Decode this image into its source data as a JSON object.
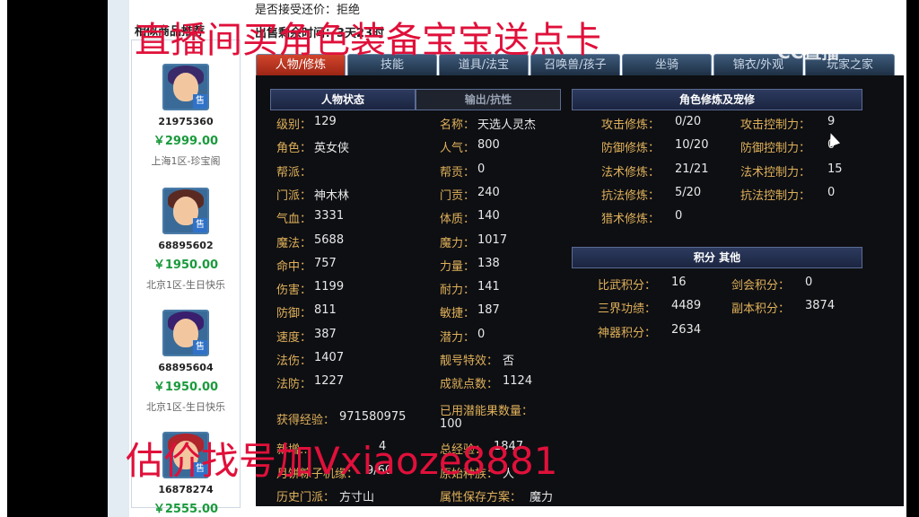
{
  "header": {
    "accept_offer_label": "是否接受还价：",
    "accept_offer_value": "拒绝",
    "left_title": "相似商品推荐",
    "sale_remaining": "出售剩余时间：3天23时"
  },
  "overlay": {
    "top_banner": "直播间买角色装备宝宝送点卡",
    "bottom_banner": "估价找号加Vxiaoze8881",
    "watermark_1": "CC直播",
    "watermark_2": "CC直播"
  },
  "sell_list": [
    {
      "id": "21975360",
      "price": "￥2999.00",
      "server": "上海1区-珍宝阁",
      "badge": "售"
    },
    {
      "id": "68895602",
      "price": "￥1950.00",
      "server": "北京1区-生日快乐",
      "badge": "售"
    },
    {
      "id": "68895604",
      "price": "￥1950.00",
      "server": "北京1区-生日快乐",
      "badge": "售"
    },
    {
      "id": "16878274",
      "price": "￥2555.00",
      "server": "",
      "badge": "售"
    }
  ],
  "tabs": [
    "人物/修炼",
    "技能",
    "道具/法宝",
    "召唤兽/孩子",
    "坐骑",
    "锦衣/外观",
    "玩家之家"
  ],
  "sections": {
    "char_status": "人物状态",
    "output_resist": "输出/抗性",
    "cultivation": "角色修炼及宠修",
    "score_other": "积分  其他"
  },
  "stats_left": [
    {
      "label": "级别：",
      "value": "129"
    },
    {
      "label": "角色：",
      "value": "英女侠"
    },
    {
      "label": "帮派：",
      "value": ""
    },
    {
      "label": "门派：",
      "value": "神木林"
    },
    {
      "label": "气血：",
      "value": "3331"
    },
    {
      "label": "魔法：",
      "value": "5688"
    },
    {
      "label": "命中：",
      "value": "757"
    },
    {
      "label": "伤害：",
      "value": "1199"
    },
    {
      "label": "防御：",
      "value": "811"
    },
    {
      "label": "速度：",
      "value": "387"
    },
    {
      "label": "法伤：",
      "value": "1407"
    },
    {
      "label": "法防：",
      "value": "1227"
    }
  ],
  "stats_right": [
    {
      "label": "名称：",
      "value": "天选人灵杰"
    },
    {
      "label": "人气：",
      "value": "800"
    },
    {
      "label": "帮贡：",
      "value": "0"
    },
    {
      "label": "门贡：",
      "value": "240"
    },
    {
      "label": "体质：",
      "value": "140"
    },
    {
      "label": "魔力：",
      "value": "1017"
    },
    {
      "label": "力量：",
      "value": "138"
    },
    {
      "label": "耐力：",
      "value": "141"
    },
    {
      "label": "敏捷：",
      "value": "187"
    },
    {
      "label": "潜力：",
      "value": "0"
    },
    {
      "label": "靓号特效：",
      "value": "否"
    },
    {
      "label": "成就点数：",
      "value": "1124"
    }
  ],
  "extra": {
    "exp_label": "获得经验：",
    "exp_value": "971580975",
    "potential_label": "已用潜能果数量：",
    "potential_value": "100",
    "new_label": "新增…",
    "new_value": "4",
    "total_exp_label": "总经验：",
    "total_exp_value": "1847",
    "month_label": "月饼粽子机缘：",
    "month_value": "9/60",
    "origin_label": "原始种族：",
    "origin_value": "人",
    "history_label": "历史门派：",
    "history_value": "方寸山",
    "save_label": "属性保存方案：",
    "save_value": "魔力"
  },
  "cultivation": [
    {
      "label": "攻击修炼：",
      "value": "0/20",
      "label2": "攻击控制力：",
      "value2": "9"
    },
    {
      "label": "防御修炼：",
      "value": "10/20",
      "label2": "防御控制力：",
      "value2": "0"
    },
    {
      "label": "法术修炼：",
      "value": "21/21",
      "label2": "法术控制力：",
      "value2": "15"
    },
    {
      "label": "抗法修炼：",
      "value": "5/20",
      "label2": "抗法控制力：",
      "value2": "0"
    },
    {
      "label": "猎术修炼：",
      "value": "0",
      "label2": "",
      "value2": ""
    }
  ],
  "scores": [
    {
      "label": "比武积分：",
      "value": "16",
      "label2": "剑会积分：",
      "value2": "0"
    },
    {
      "label": "三界功绩：",
      "value": "4489",
      "label2": "副本积分：",
      "value2": "3874"
    },
    {
      "label": "神器积分：",
      "value": "2634",
      "label2": "",
      "value2": ""
    }
  ]
}
